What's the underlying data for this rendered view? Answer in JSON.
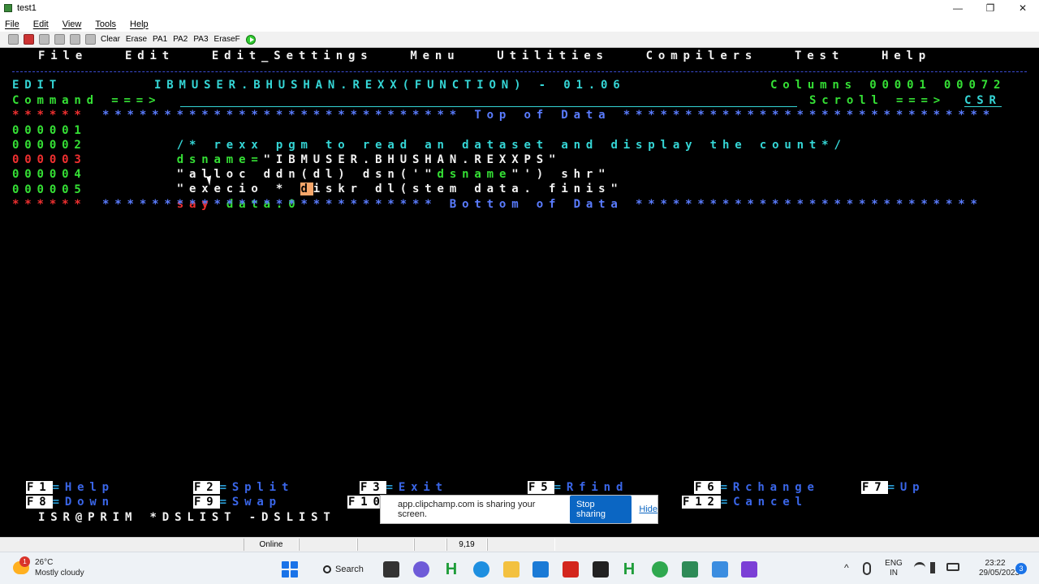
{
  "window": {
    "title": "test1",
    "controls": [
      "—",
      "❐",
      "✕"
    ]
  },
  "menubar": [
    "File",
    "Edit",
    "View",
    "Tools",
    "Help"
  ],
  "toolbar": {
    "buttons": [
      "Clear",
      "Erase",
      "PA1",
      "PA2",
      "PA3",
      "EraseF"
    ]
  },
  "terminal": {
    "ispf_menu": "File   Edit   Edit_Settings   Menu   Utilities   Compilers   Test   Help",
    "edit_label": "EDIT",
    "dataset": "IBMUSER.BHUSHAN.REXX(FUNCTION) - 01.06",
    "columns": "Columns 00001 00072",
    "command_label": "Command ===>",
    "command_value": "",
    "scroll_label": "Scroll ===>",
    "scroll_value": "CSR",
    "top_prefix": "******",
    "top_text": "***************************** Top of Data ******************************",
    "lines": [
      {
        "num": "000001",
        "parts": [
          {
            "text": "/* rexx pgm to read an dataset and display the count*/",
            "color": "cyan"
          }
        ]
      },
      {
        "num": "000002",
        "parts": [
          {
            "text": "dsname=",
            "color": "green"
          },
          {
            "text": "\"IBMUSER.BHUSHAN.REXXPS\"",
            "color": "white"
          }
        ]
      },
      {
        "num": "000003",
        "parts": [
          {
            "text": "\"alloc ddn(dl) dsn('\"",
            "color": "white"
          },
          {
            "text": "dsname",
            "color": "green"
          },
          {
            "text": "\"') shr\"",
            "color": "white"
          }
        ]
      },
      {
        "num": "000004",
        "parts": [
          {
            "text": "\"execio * ",
            "color": "white"
          },
          {
            "text": "d",
            "color": "highlight"
          },
          {
            "text": "iskr dl(stem data. finis\"",
            "color": "white"
          }
        ]
      },
      {
        "num": "000005",
        "parts": [
          {
            "text": "say ",
            "color": "red"
          },
          {
            "text": "data.0",
            "color": "green"
          }
        ]
      }
    ],
    "bottom_prefix": "******",
    "bottom_text": "*************************** Bottom of Data ****************************",
    "fkeys": [
      {
        "key": "F1",
        "action": "Help"
      },
      {
        "key": "F2",
        "action": "Split"
      },
      {
        "key": "F3",
        "action": "Exit"
      },
      {
        "key": "F5",
        "action": "Rfind"
      },
      {
        "key": "F6",
        "action": "Rchange"
      },
      {
        "key": "F7",
        "action": "Up"
      },
      {
        "key": "F8",
        "action": "Down"
      },
      {
        "key": "F9",
        "action": "Swap"
      },
      {
        "key": "F10",
        "action": ""
      },
      {
        "key": "F12",
        "action": "Cancel"
      }
    ],
    "bottom_line": "ISR@PRIM *DSLIST -DSLIST"
  },
  "share_bar": {
    "message": "app.clipchamp.com is sharing your screen.",
    "stop": "Stop sharing",
    "hide": "Hide"
  },
  "statusbar": {
    "connection": "Online",
    "cursor_pos": "9,19"
  },
  "taskbar": {
    "weather_temp": "26°C",
    "weather_desc": "Mostly cloudy",
    "weather_badge": "1",
    "search": "Search",
    "lang_top": "ENG",
    "lang_bottom": "IN",
    "time": "23:22",
    "date": "29/05/2023",
    "notifications": "3"
  },
  "colors": {
    "white": "#f2f2f2",
    "cyan": "#35d6d6",
    "green": "#35e035",
    "red": "#f03030",
    "blue": "#5a7cff",
    "highlight": "#f6a66a"
  }
}
